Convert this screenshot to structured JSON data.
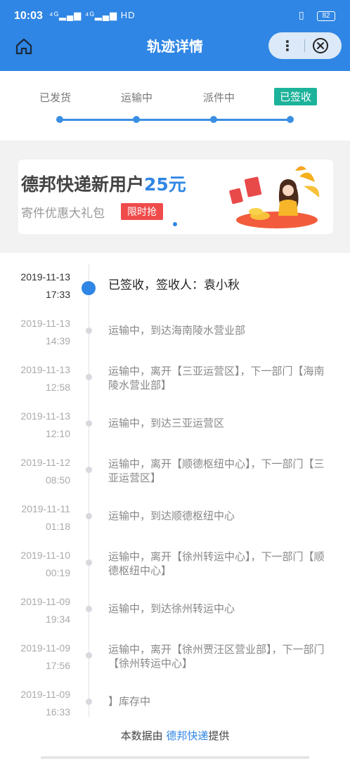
{
  "status_bar": {
    "time": "10:03",
    "signals": "⁴ᴳ▂▄▆ ⁴ᴳ▂▄▆ HD",
    "vibrate_icon": "vibrate-icon",
    "battery": "82"
  },
  "header": {
    "title": "轨迹详情",
    "home_icon": "home-icon",
    "more_icon": "more-icon",
    "more_glyph": "⋮",
    "close_icon": "close-icon",
    "bg_color": "#2f86e4"
  },
  "steps": {
    "items": [
      {
        "label": "已发货"
      },
      {
        "label": "运输中"
      },
      {
        "label": "派件中"
      },
      {
        "label": "已签收"
      }
    ],
    "active_index": 3,
    "active_color": "#1db39b"
  },
  "banner": {
    "headline": "德邦快递新用户",
    "amount": "25元",
    "subtitle": "寄件优惠大礼包",
    "tag": "限时抢",
    "tag_color": "#ef4b4b"
  },
  "timeline": [
    {
      "date": "2019-11-13",
      "time": "17:33",
      "text": "已签收，签收人：袁小秋",
      "active": true
    },
    {
      "date": "2019-11-13",
      "time": "14:39",
      "text": "运输中，到达海南陵水营业部"
    },
    {
      "date": "2019-11-13",
      "time": "12:58",
      "text": "运输中，离开【三亚运营区】，下一部门【海南陵水营业部】"
    },
    {
      "date": "2019-11-13",
      "time": "12:10",
      "text": "运输中，到达三亚运营区"
    },
    {
      "date": "2019-11-12",
      "time": "08:50",
      "text": "运输中，离开【顺德枢纽中心】，下一部门【三亚运营区】"
    },
    {
      "date": "2019-11-11",
      "time": "01:18",
      "text": "运输中，到达顺德枢纽中心"
    },
    {
      "date": "2019-11-10",
      "time": "00:19",
      "text": "运输中，离开【徐州转运中心】，下一部门【顺德枢纽中心】"
    },
    {
      "date": "2019-11-09",
      "time": "19:34",
      "text": "运输中，到达徐州转运中心"
    },
    {
      "date": "2019-11-09",
      "time": "17:56",
      "text": "运输中，离开【徐州贾汪区营业部】，下一部门【徐州转运中心】"
    },
    {
      "date": "2019-11-09",
      "time": "16:33",
      "text": "】库存中"
    }
  ],
  "footer": {
    "prefix": "本数据由 ",
    "brand": "德邦快递",
    "suffix": "提供"
  }
}
